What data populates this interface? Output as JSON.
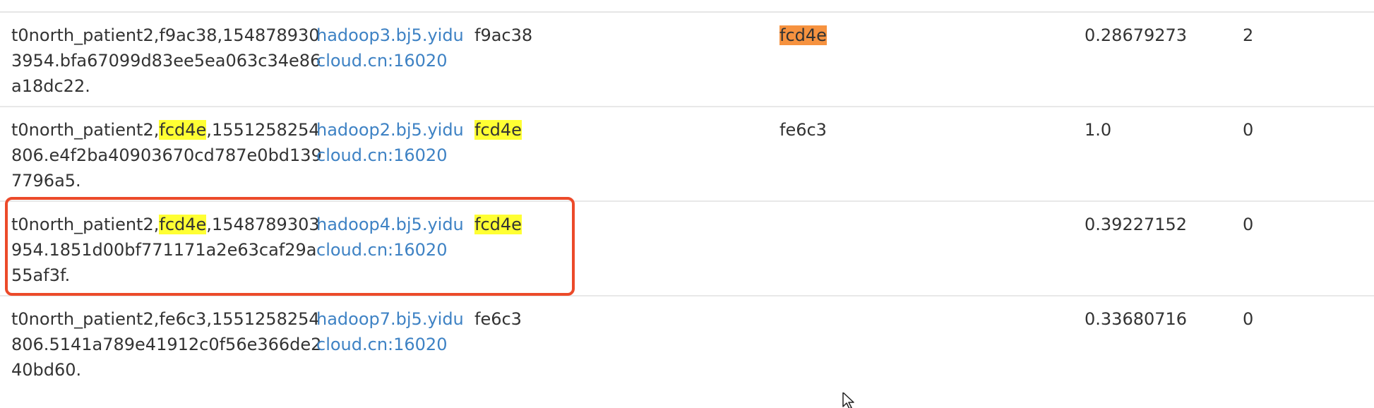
{
  "rows": [
    {
      "region": {
        "lines": [
          {
            "parts": [
              {
                "text": "t0north_patient2,f9ac38,154878930",
                "hl": ""
              }
            ]
          },
          {
            "parts": [
              {
                "text": "3954.bfa67099d83ee5ea063c34e86",
                "hl": ""
              }
            ]
          },
          {
            "parts": [
              {
                "text": "a18dc22.",
                "hl": ""
              }
            ]
          }
        ]
      },
      "server": {
        "lines": [
          "hadoop3.bj5.yidu",
          "cloud.cn:16020"
        ]
      },
      "start_key": {
        "text": "f9ac38",
        "hl": ""
      },
      "end_key": {
        "text": "fcd4e",
        "hl": "orange"
      },
      "locality": "0.28679273",
      "requests": "2"
    },
    {
      "region": {
        "lines": [
          {
            "parts": [
              {
                "text": "t0north_patient2,",
                "hl": ""
              },
              {
                "text": "fcd4e",
                "hl": "yellow"
              },
              {
                "text": ",1551258254",
                "hl": ""
              }
            ]
          },
          {
            "parts": [
              {
                "text": "806.e4f2ba40903670cd787e0bd139",
                "hl": ""
              }
            ]
          },
          {
            "parts": [
              {
                "text": "7796a5.",
                "hl": ""
              }
            ]
          }
        ]
      },
      "server": {
        "lines": [
          "hadoop2.bj5.yidu",
          "cloud.cn:16020"
        ]
      },
      "start_key": {
        "text": "fcd4e",
        "hl": "yellow"
      },
      "end_key": {
        "text": "fe6c3",
        "hl": ""
      },
      "locality": "1.0",
      "requests": "0"
    },
    {
      "region": {
        "lines": [
          {
            "parts": [
              {
                "text": "t0north_patient2,",
                "hl": ""
              },
              {
                "text": "fcd4e",
                "hl": "yellow"
              },
              {
                "text": ",1548789303",
                "hl": ""
              }
            ]
          },
          {
            "parts": [
              {
                "text": "954.1851d00bf771171a2e63caf29a",
                "hl": ""
              }
            ]
          },
          {
            "parts": [
              {
                "text": "55af3f.",
                "hl": ""
              }
            ]
          }
        ]
      },
      "server": {
        "lines": [
          "hadoop4.bj5.yidu",
          "cloud.cn:16020"
        ]
      },
      "start_key": {
        "text": "fcd4e",
        "hl": "yellow"
      },
      "end_key": {
        "text": "",
        "hl": ""
      },
      "locality": "0.39227152",
      "requests": "0"
    },
    {
      "region": {
        "lines": [
          {
            "parts": [
              {
                "text": "t0north_patient2,fe6c3,1551258254",
                "hl": ""
              }
            ]
          },
          {
            "parts": [
              {
                "text": "806.5141a789e41912c0f56e366de2",
                "hl": ""
              }
            ]
          },
          {
            "parts": [
              {
                "text": "40bd60.",
                "hl": ""
              }
            ]
          }
        ]
      },
      "server": {
        "lines": [
          "hadoop7.bj5.yidu",
          "cloud.cn:16020"
        ]
      },
      "start_key": {
        "text": "fe6c3",
        "hl": ""
      },
      "end_key": {
        "text": "",
        "hl": ""
      },
      "locality": "0.33680716",
      "requests": "0"
    }
  ],
  "annotation": {
    "highlighted_row_index": 2,
    "color": "#ec4a2a"
  },
  "highlight_colors": {
    "yellow": "#ffff33",
    "orange": "#f6923f"
  },
  "link_color": "#3e82c4",
  "cursor_icon": "mouse-pointer-icon"
}
